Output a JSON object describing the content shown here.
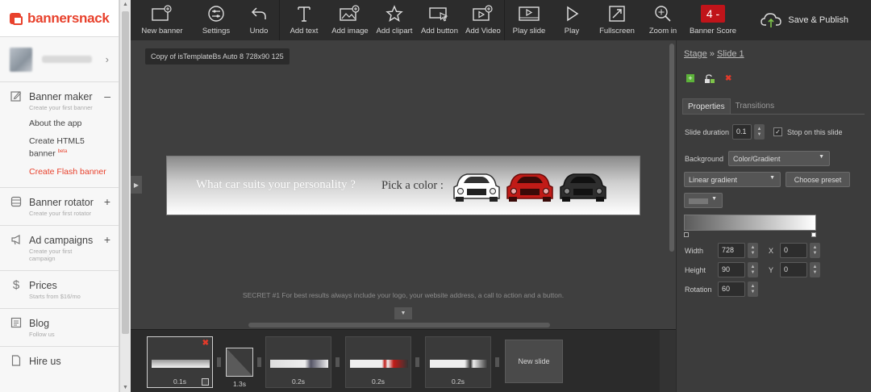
{
  "brand": {
    "name": "bannersnack",
    "accent": "#e8412c"
  },
  "sidebar": {
    "user_chevron": "›",
    "banner_maker": {
      "title": "Banner maker",
      "sign": "–",
      "subtitle": "Create your first banner",
      "links": {
        "about": "About the app",
        "html5": "Create HTML5 banner",
        "html5_badge": "beta",
        "flash": "Create Flash banner"
      }
    },
    "banner_rotator": {
      "title": "Banner rotator",
      "sign": "+",
      "subtitle": "Create your first rotator"
    },
    "ad_campaigns": {
      "title": "Ad campaigns",
      "sign": "+",
      "subtitle": "Create your first campaign"
    },
    "prices": {
      "title": "Prices",
      "subtitle": "Starts from $16/mo"
    },
    "blog": {
      "title": "Blog",
      "subtitle": "Follow us"
    },
    "hire_us": {
      "title": "Hire us"
    }
  },
  "toolbar": {
    "new_banner": "New banner",
    "settings": "Settings",
    "undo": "Undo",
    "add_text": "Add text",
    "add_image": "Add image",
    "add_clipart": "Add clipart",
    "add_button": "Add button",
    "add_video": "Add Video",
    "play_slide": "Play slide",
    "play": "Play",
    "fullscreen": "Fullscreen",
    "zoom_in": "Zoom in",
    "banner_score_label": "Banner Score",
    "banner_score_value": "4 -",
    "save_publish": "Save & Publish"
  },
  "canvas": {
    "doc_title": "Copy of isTemplateBs Auto 8 728x90 125",
    "banner_question": "What car suits your personality ?",
    "banner_pick": "Pick a color :",
    "car_colors": [
      "#ffffff",
      "#c11b17",
      "#2e2e2e"
    ],
    "tip": "SECRET #1 For best results always include your logo, your website address, a call to action and a button."
  },
  "slides": {
    "items": [
      {
        "duration": "0.1s"
      },
      {
        "duration": "0.2s"
      },
      {
        "duration": "0.2s"
      },
      {
        "duration": "0.2s"
      }
    ],
    "transition_duration": "1.3s",
    "new_slide": "New slide"
  },
  "properties": {
    "breadcrumb_stage": "Stage",
    "breadcrumb_sep": "»",
    "breadcrumb_slide": "Slide 1",
    "tab_properties": "Properties",
    "tab_transitions": "Transitions",
    "slide_duration_label": "Slide duration",
    "slide_duration_value": "0.1",
    "stop_on_slide": "Stop on this slide",
    "background_label": "Background",
    "background_value": "Color/Gradient",
    "gradient_type": "Linear gradient",
    "choose_preset": "Choose preset",
    "width_label": "Width",
    "width_value": "728",
    "height_label": "Height",
    "height_value": "90",
    "rotation_label": "Rotation",
    "rotation_value": "60",
    "x_label": "X",
    "x_value": "0",
    "y_label": "Y",
    "y_value": "0"
  }
}
